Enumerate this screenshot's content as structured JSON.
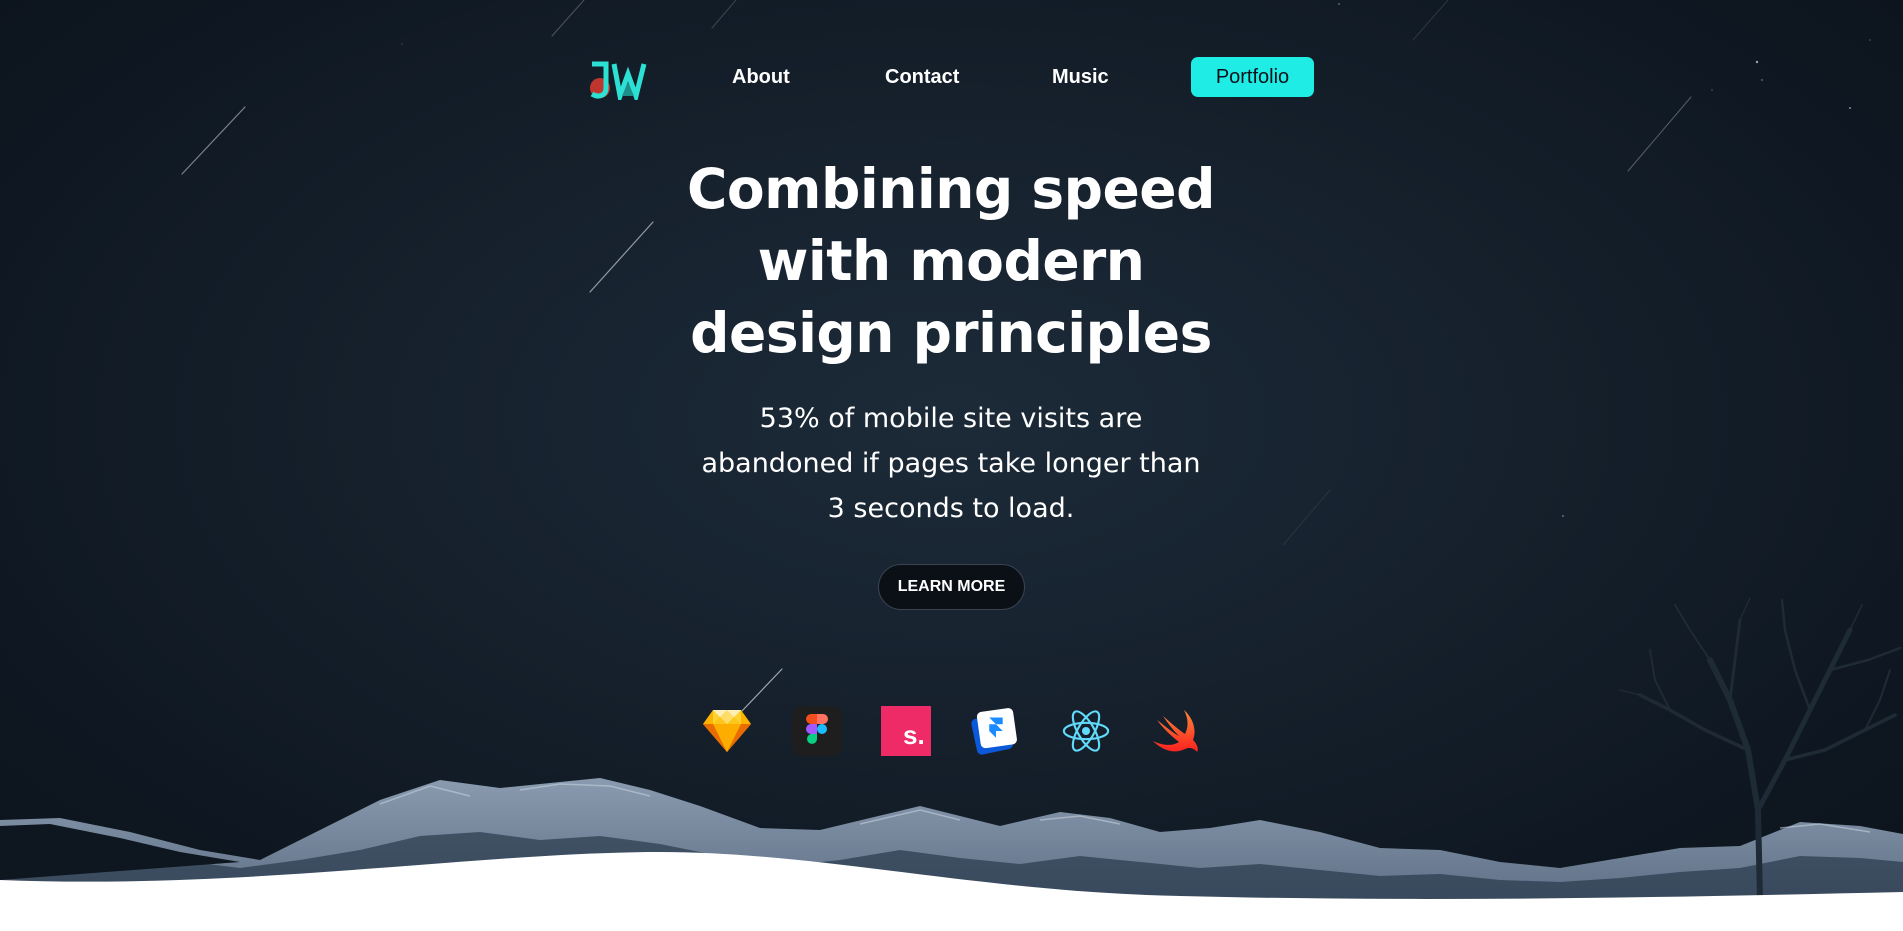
{
  "nav": {
    "logo_text": "JW",
    "links": [
      {
        "label": "About"
      },
      {
        "label": "Contact"
      },
      {
        "label": "Music"
      }
    ],
    "portfolio_label": "Portfolio"
  },
  "hero": {
    "headline": "Combining speed with modern design principles",
    "subtext": "53% of mobile site visits are abandoned if pages take longer than 3 seconds to load.",
    "cta_label": "LEARN MORE"
  },
  "tools": [
    {
      "name": "sketch-icon"
    },
    {
      "name": "figma-icon"
    },
    {
      "name": "sitepoint-icon",
      "text": "s."
    },
    {
      "name": "framer-icon"
    },
    {
      "name": "react-icon"
    },
    {
      "name": "swift-icon"
    }
  ],
  "colors": {
    "accent": "#1fece4",
    "background": "#16212d",
    "button_dark": "#0b0f16"
  }
}
